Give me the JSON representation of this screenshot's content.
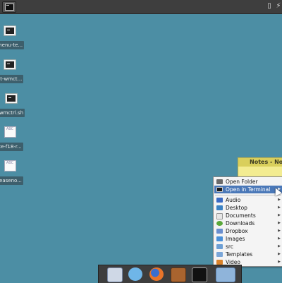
{
  "desktop_items": [
    {
      "label": "menu-te...",
      "icon": "terminal-script-icon"
    },
    {
      "label": "st-wmct...",
      "icon": "terminal-script-icon"
    },
    {
      "label": "wmctrl.sh",
      "icon": "terminal-script-icon"
    },
    {
      "label": "ce-f18-r...",
      "icon": "text-file-icon"
    },
    {
      "label": "leaseno...",
      "icon": "text-file-icon"
    }
  ],
  "text_icon_glyph": "ABC",
  "notes": {
    "title": "Notes - No"
  },
  "context_menu": {
    "items": [
      {
        "label": "Open Folder"
      },
      {
        "label": "Open in Terminal",
        "highlighted": true
      }
    ],
    "folders": [
      {
        "label": "Audio"
      },
      {
        "label": "Desktop"
      },
      {
        "label": "Documents"
      },
      {
        "label": "Downloads"
      },
      {
        "label": "Dropbox"
      },
      {
        "label": "Images"
      },
      {
        "label": "src"
      },
      {
        "label": "Templates"
      },
      {
        "label": "Video"
      }
    ]
  },
  "dock": [
    "mail-icon",
    "browser-icon",
    "firefox-icon",
    "home-icon",
    "terminal-icon",
    "folder-icon"
  ],
  "colors": {
    "desktop_bg": "#4c8ea4",
    "highlight": "#4a78b8",
    "notes_bg": "#f3ec91"
  }
}
